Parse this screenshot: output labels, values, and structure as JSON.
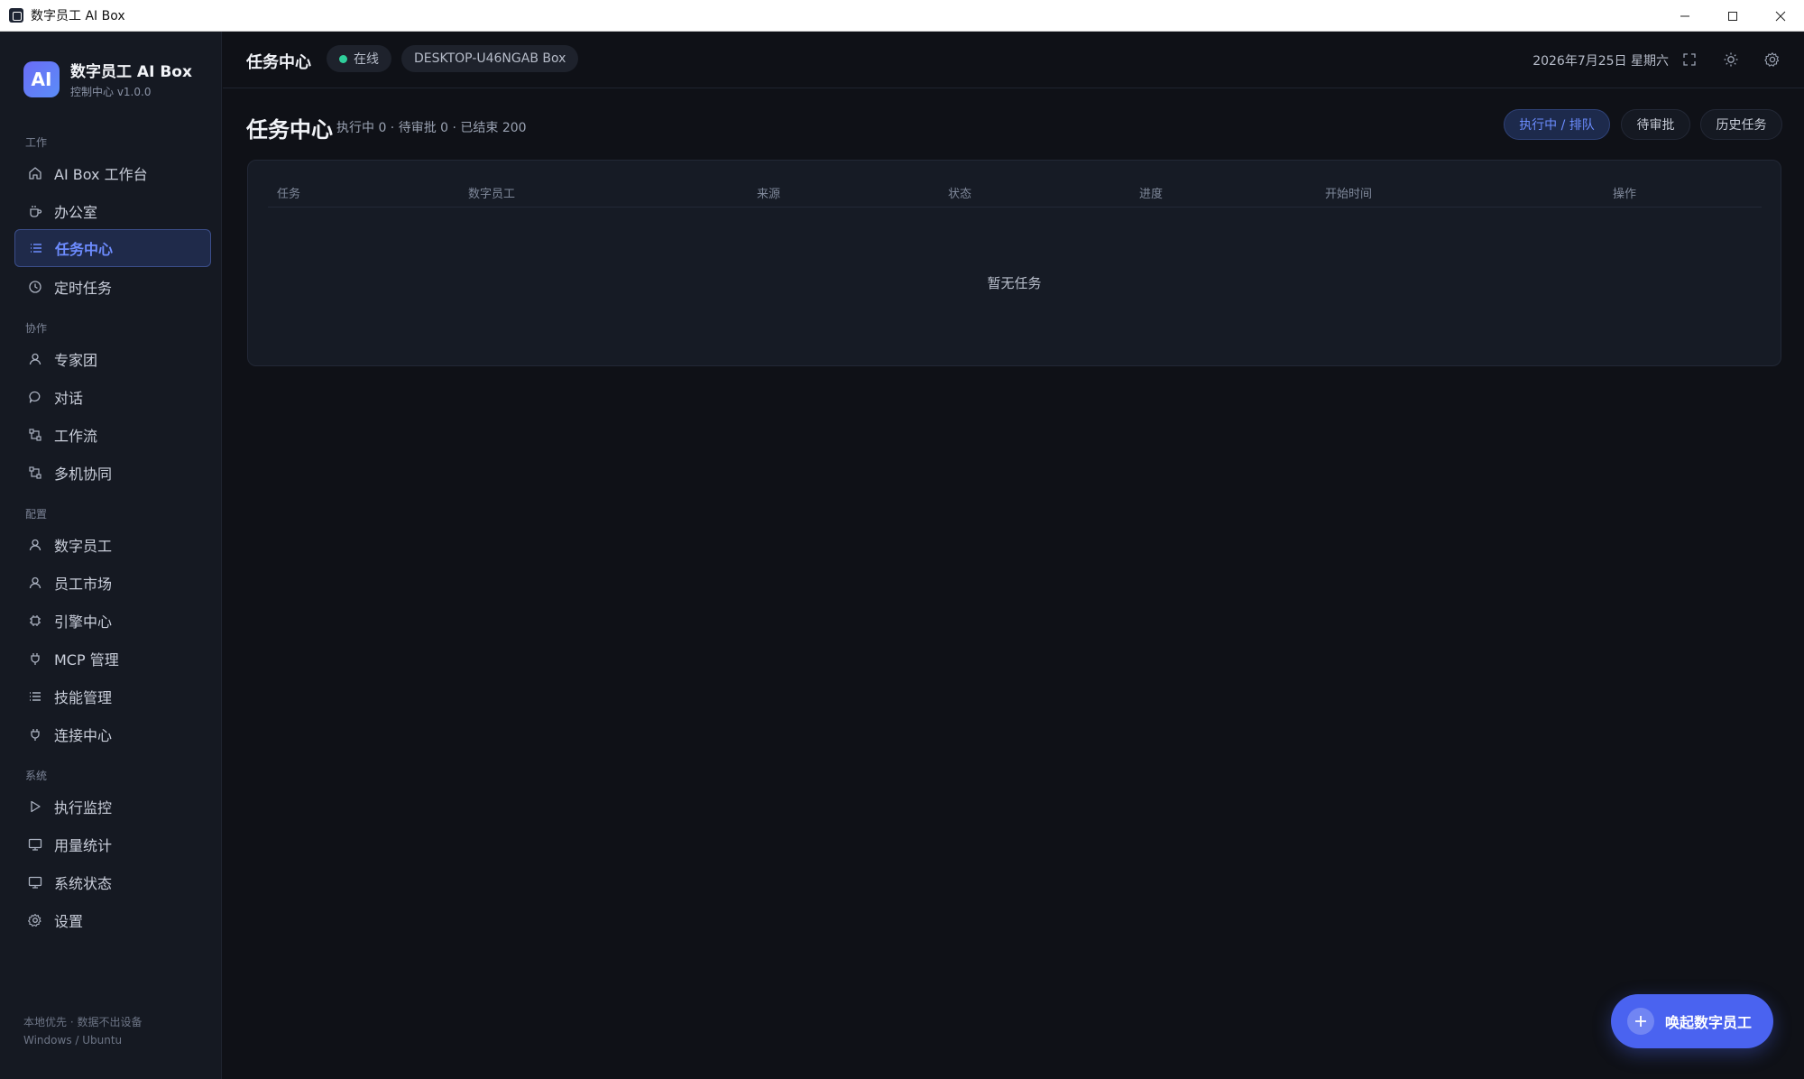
{
  "window": {
    "title": "数字员工 AI Box"
  },
  "brand": {
    "logo": "AI",
    "name": "数字员工 AI Box",
    "subtitle": "控制中心 v1.0.0"
  },
  "sidebar": {
    "sections": [
      {
        "label": "工作",
        "items": [
          {
            "label": "AI Box 工作台",
            "icon": "home-icon"
          },
          {
            "label": "办公室",
            "icon": "cup-icon"
          },
          {
            "label": "任务中心",
            "icon": "list-icon",
            "active": true
          },
          {
            "label": "定时任务",
            "icon": "clock-icon"
          }
        ]
      },
      {
        "label": "协作",
        "items": [
          {
            "label": "专家团",
            "icon": "user-icon"
          },
          {
            "label": "对话",
            "icon": "chat-icon"
          },
          {
            "label": "工作流",
            "icon": "workflow-icon"
          },
          {
            "label": "多机协同",
            "icon": "workflow-icon"
          }
        ]
      },
      {
        "label": "配置",
        "items": [
          {
            "label": "数字员工",
            "icon": "user-icon"
          },
          {
            "label": "员工市场",
            "icon": "user-icon"
          },
          {
            "label": "引擎中心",
            "icon": "engine-icon"
          },
          {
            "label": "MCP 管理",
            "icon": "plug-icon"
          },
          {
            "label": "技能管理",
            "icon": "list-icon"
          },
          {
            "label": "连接中心",
            "icon": "plug-icon"
          }
        ]
      },
      {
        "label": "系统",
        "items": [
          {
            "label": "执行监控",
            "icon": "play-icon"
          },
          {
            "label": "用量统计",
            "icon": "monitor-icon"
          },
          {
            "label": "系统状态",
            "icon": "monitor-icon"
          },
          {
            "label": "设置",
            "icon": "gear-icon"
          }
        ]
      }
    ],
    "footer_line1": "本地优先 · 数据不出设备",
    "footer_line2": "Windows / Ubuntu"
  },
  "topbar": {
    "title": "任务中心",
    "status": "在线",
    "device": "DESKTOP-U46NGAB Box",
    "date": "2026年7月25日 星期六"
  },
  "page": {
    "title": "任务中心",
    "stats": "执行中 0 · 待审批 0 · 已结束 200",
    "tabs": [
      {
        "label": "执行中 / 排队",
        "active": true
      },
      {
        "label": "待审批",
        "active": false
      },
      {
        "label": "历史任务",
        "active": false
      }
    ]
  },
  "table": {
    "columns": [
      "任务",
      "数字员工",
      "来源",
      "状态",
      "进度",
      "开始时间",
      "操作"
    ],
    "rows": [],
    "empty_text": "暂无任务"
  },
  "fab": {
    "label": "唤起数字员工"
  },
  "colors": {
    "accent": "#4a63f0",
    "accent_text": "#6d8cff",
    "online": "#2fcf9b",
    "background": "#0f1117",
    "sidebar": "#151922"
  }
}
